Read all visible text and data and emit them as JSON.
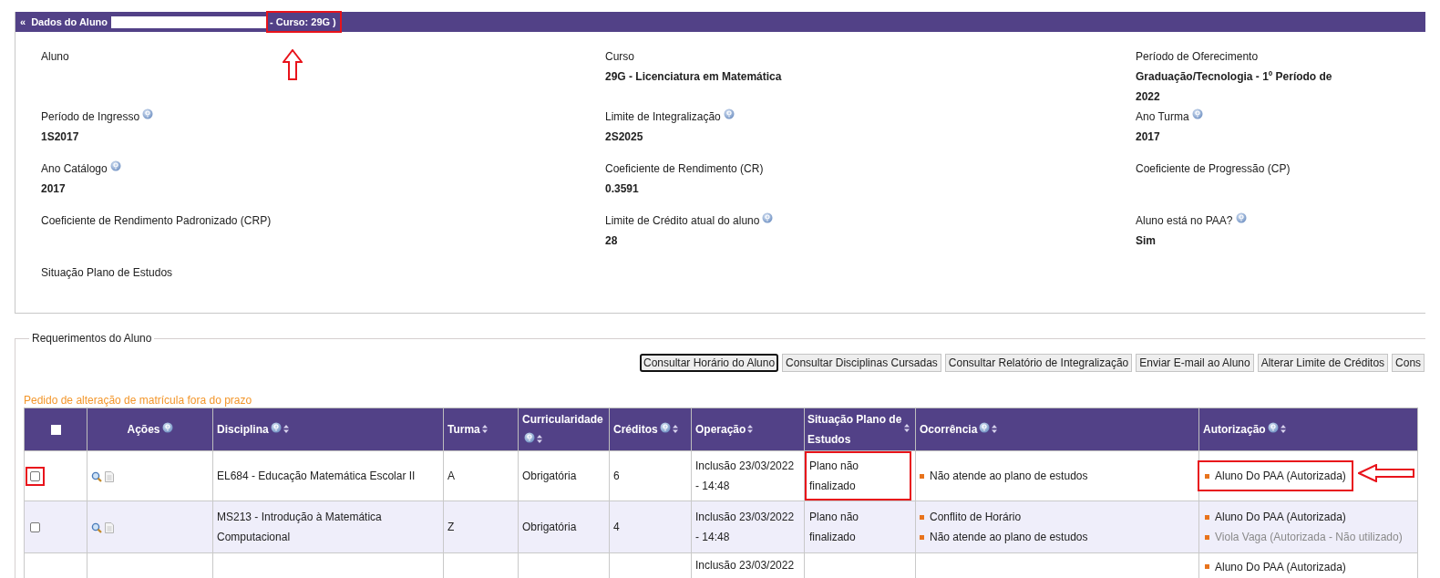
{
  "student_panel": {
    "collapse_glyph": "«",
    "title": "Dados do Aluno",
    "title_suffix": "- Curso: 29G )",
    "suffix_highlighted": true,
    "suffix_arrow": true,
    "fields": [
      {
        "label": "Aluno",
        "help": false
      },
      {
        "label": "Curso",
        "value": "29G - Licenciatura em Matemática",
        "help": false
      },
      {
        "label": "Período de Oferecimento",
        "value": "Graduação/Tecnologia - 1º Período de 2022",
        "help": false
      },
      {
        "label": "Período de Ingresso",
        "value": "1S2017",
        "help": true
      },
      {
        "label": "Limite de Integralização",
        "value": "2S2025",
        "help": true
      },
      {
        "label": "Ano Turma",
        "value": "2017",
        "help": true
      },
      {
        "label": "Ano Catálogo",
        "value": "2017",
        "help": true
      },
      {
        "label": "Coeficiente de Rendimento (CR)",
        "value": "0.3591",
        "help": false
      },
      {
        "label": "Coeficiente de Progressão (CP)",
        "help": false
      },
      {
        "label": "Coeficiente de Rendimento Padronizado (CRP)",
        "help": false
      },
      {
        "label": "Limite de Crédito atual do aluno",
        "value": "28",
        "help": true
      },
      {
        "label": "Aluno está no PAA?",
        "value": "Sim",
        "help": true
      },
      {
        "label": "Situação Plano de Estudos",
        "help": false
      }
    ]
  },
  "requests": {
    "legend": "Requerimentos do Aluno",
    "buttons": [
      {
        "label": "Consultar Horário do Aluno",
        "focused": true
      },
      {
        "label": "Consultar Disciplinas Cursadas",
        "focused": false
      },
      {
        "label": "Consultar Relatório de Integralização",
        "focused": false
      },
      {
        "label": "Enviar E-mail ao Aluno",
        "focused": false
      },
      {
        "label": "Alterar Limite de Créditos",
        "focused": false
      },
      {
        "label": "Cons",
        "focused": false
      }
    ],
    "table_title": "Pedido de alteração de matrícula fora do prazo",
    "select_all_checked": false,
    "columns": [
      {
        "label": "Ações",
        "help": true,
        "sortable": false
      },
      {
        "label": "Disciplina",
        "help": true,
        "sortable": true
      },
      {
        "label": "Turma",
        "help": false,
        "sortable": true
      },
      {
        "label": "Curricularidade",
        "help": true,
        "sortable": true
      },
      {
        "label": "Créditos",
        "help": true,
        "sortable": true
      },
      {
        "label": "Operação",
        "help": false,
        "sortable": true
      },
      {
        "label": "Situação Plano de Estudos",
        "help": false,
        "sortable": true
      },
      {
        "label": "Ocorrência",
        "help": true,
        "sortable": true
      },
      {
        "label": "Autorização",
        "help": true,
        "sortable": true
      }
    ],
    "rows": [
      {
        "checked": false,
        "check_highlighted": true,
        "disciplina": "EL684 - Educação Matemática Escolar II",
        "turma": "A",
        "curricularidade": "Obrigatória",
        "creditos": "6",
        "operacao": "Inclusão 23/03/2022 - 14:48",
        "situacao": "Plano não finalizado",
        "situacao_highlighted": true,
        "ocorrencias": [
          "Não atende ao plano de estudos"
        ],
        "autorizacoes": [
          {
            "text": "Aluno Do PAA (Autorizada)",
            "muted": false
          }
        ],
        "autorizacao_highlighted": true,
        "autorizacao_arrow": true
      },
      {
        "checked": false,
        "check_highlighted": false,
        "disciplina": "MS213 - Introdução à Matemática Computacional",
        "turma": "Z",
        "curricularidade": "Obrigatória",
        "creditos": "4",
        "operacao": "Inclusão 23/03/2022 - 14:48",
        "situacao": "Plano não finalizado",
        "situacao_highlighted": false,
        "ocorrencias": [
          "Conflito de Horário",
          "Não atende ao plano de estudos"
        ],
        "autorizacoes": [
          {
            "text": "Aluno Do PAA (Autorizada)",
            "muted": false
          },
          {
            "text": "Viola Vaga (Autorizada - Não utilizado)",
            "muted": true
          }
        ],
        "autorizacao_highlighted": false
      },
      {
        "operacao": "Inclusão 23/03/2022",
        "autorizacoes": [
          {
            "text": "Aluno Do PAA (Autorizada)",
            "muted": false
          }
        ]
      }
    ]
  }
}
